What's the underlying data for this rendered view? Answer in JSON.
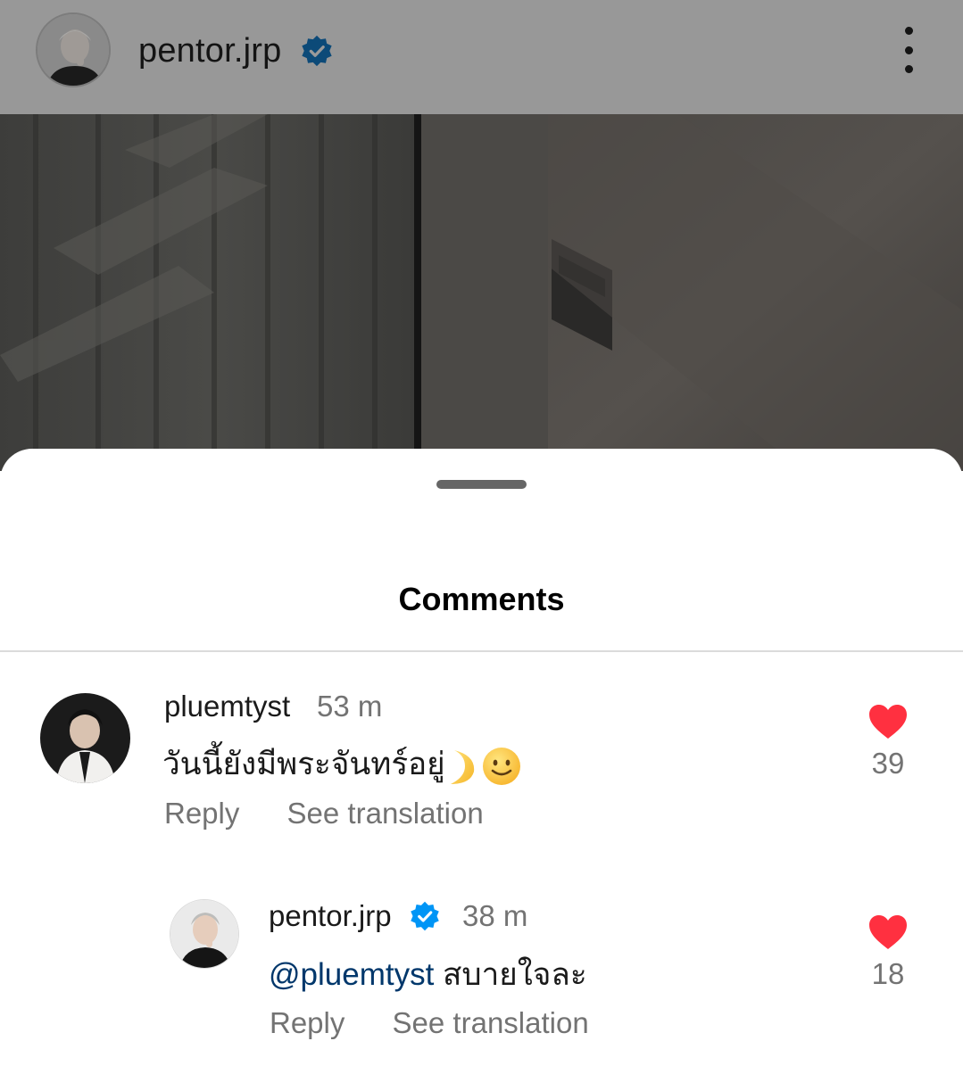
{
  "header": {
    "username": "pentor.jrp",
    "verified_icon": "verified-badge-icon",
    "menu_icon": "more-vertical-icon",
    "verified_color": "#0095f6"
  },
  "sheet": {
    "title": "Comments"
  },
  "comments": [
    {
      "username": "pluemtyst",
      "time": "53 m",
      "text": "วันนี้ยังมีพระจันทร์อยู่",
      "emojis": [
        "crescent-moon-icon",
        "slightly-smiling-face-icon"
      ],
      "reply_label": "Reply",
      "translate_label": "See translation",
      "like_count": "39",
      "liked": true
    },
    {
      "username": "pentor.jrp",
      "verified": true,
      "time": "38 m",
      "mention": "@pluemtyst",
      "text": "สบายใจละ",
      "reply_label": "Reply",
      "translate_label": "See translation",
      "like_count": "18",
      "liked": true
    }
  ],
  "colors": {
    "like_red": "#ff3040",
    "mention_blue": "#00376b",
    "secondary_text": "#737373"
  }
}
